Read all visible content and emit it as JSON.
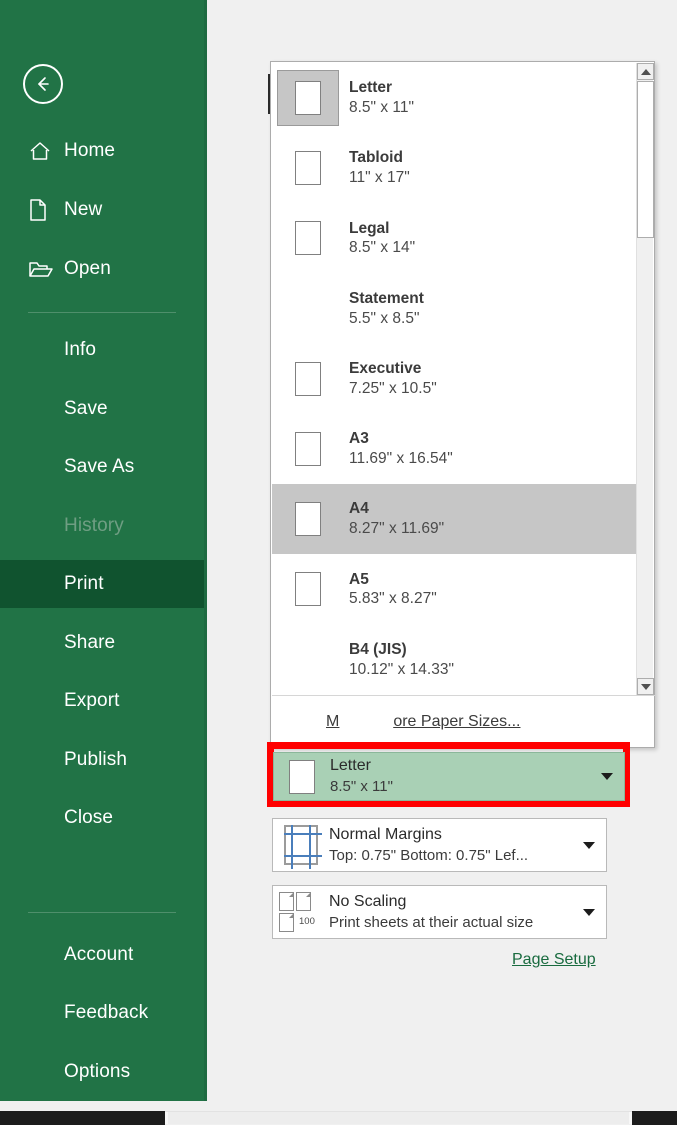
{
  "sidebar": {
    "back_label": "Back",
    "items": [
      {
        "label": "Home",
        "icon": "home-icon",
        "state": "normal"
      },
      {
        "label": "New",
        "icon": "new-file-icon",
        "state": "normal"
      },
      {
        "label": "Open",
        "icon": "open-folder-icon",
        "state": "normal"
      },
      {
        "label": "Info",
        "icon": "",
        "state": "normal"
      },
      {
        "label": "Save",
        "icon": "",
        "state": "normal"
      },
      {
        "label": "Save As",
        "icon": "",
        "state": "normal"
      },
      {
        "label": "History",
        "icon": "",
        "state": "disabled"
      },
      {
        "label": "Print",
        "icon": "",
        "state": "active"
      },
      {
        "label": "Share",
        "icon": "",
        "state": "normal"
      },
      {
        "label": "Export",
        "icon": "",
        "state": "normal"
      },
      {
        "label": "Publish",
        "icon": "",
        "state": "normal"
      },
      {
        "label": "Close",
        "icon": "",
        "state": "normal"
      },
      {
        "label": "Account",
        "icon": "",
        "state": "normal"
      },
      {
        "label": "Feedback",
        "icon": "",
        "state": "normal"
      },
      {
        "label": "Options",
        "icon": "",
        "state": "normal"
      }
    ]
  },
  "paper_popup": {
    "options": [
      {
        "name": "Letter",
        "dimensions": "8.5\" x 11\"",
        "has_icon": true,
        "icon_selected": true,
        "row_highlight": false
      },
      {
        "name": "Tabloid",
        "dimensions": "11\" x 17\"",
        "has_icon": true,
        "icon_selected": false,
        "row_highlight": false
      },
      {
        "name": "Legal",
        "dimensions": "8.5\" x 14\"",
        "has_icon": true,
        "icon_selected": false,
        "row_highlight": false
      },
      {
        "name": "Statement",
        "dimensions": "5.5\" x 8.5\"",
        "has_icon": false,
        "icon_selected": false,
        "row_highlight": false
      },
      {
        "name": "Executive",
        "dimensions": "7.25\" x 10.5\"",
        "has_icon": true,
        "icon_selected": false,
        "row_highlight": false
      },
      {
        "name": "A3",
        "dimensions": "11.69\" x 16.54\"",
        "has_icon": true,
        "icon_selected": false,
        "row_highlight": false
      },
      {
        "name": "A4",
        "dimensions": "8.27\" x 11.69\"",
        "has_icon": true,
        "icon_selected": false,
        "row_highlight": true
      },
      {
        "name": "A5",
        "dimensions": "5.83\" x 8.27\"",
        "has_icon": true,
        "icon_selected": false,
        "row_highlight": false
      },
      {
        "name": "B4 (JIS)",
        "dimensions": "10.12\" x 14.33\"",
        "has_icon": false,
        "icon_selected": false,
        "row_highlight": false
      }
    ],
    "more_sizes_accel": "M",
    "more_sizes_rest": "ore Paper Sizes..."
  },
  "settings": {
    "paper": {
      "title": "Letter",
      "subtitle": "8.5\" x 11\"",
      "icon": "paper-sheet-icon",
      "highlight_color": "#a9d0b5",
      "annotation_color": "#ff0000"
    },
    "margins": {
      "title": "Normal Margins",
      "subtitle": "Top: 0.75\" Bottom: 0.75\" Lef...",
      "icon": "margins-icon"
    },
    "scaling": {
      "title": "No Scaling",
      "subtitle": "Print sheets at their actual size",
      "icon": "scaling-icon",
      "scale_value": "100"
    },
    "page_setup_link": "Page Setup"
  },
  "colors": {
    "brand_green": "#217346",
    "active_green": "#10532f",
    "highlight_gray": "#c6c6c6",
    "accent_red": "#ff0000",
    "link_green": "#196b3f"
  }
}
